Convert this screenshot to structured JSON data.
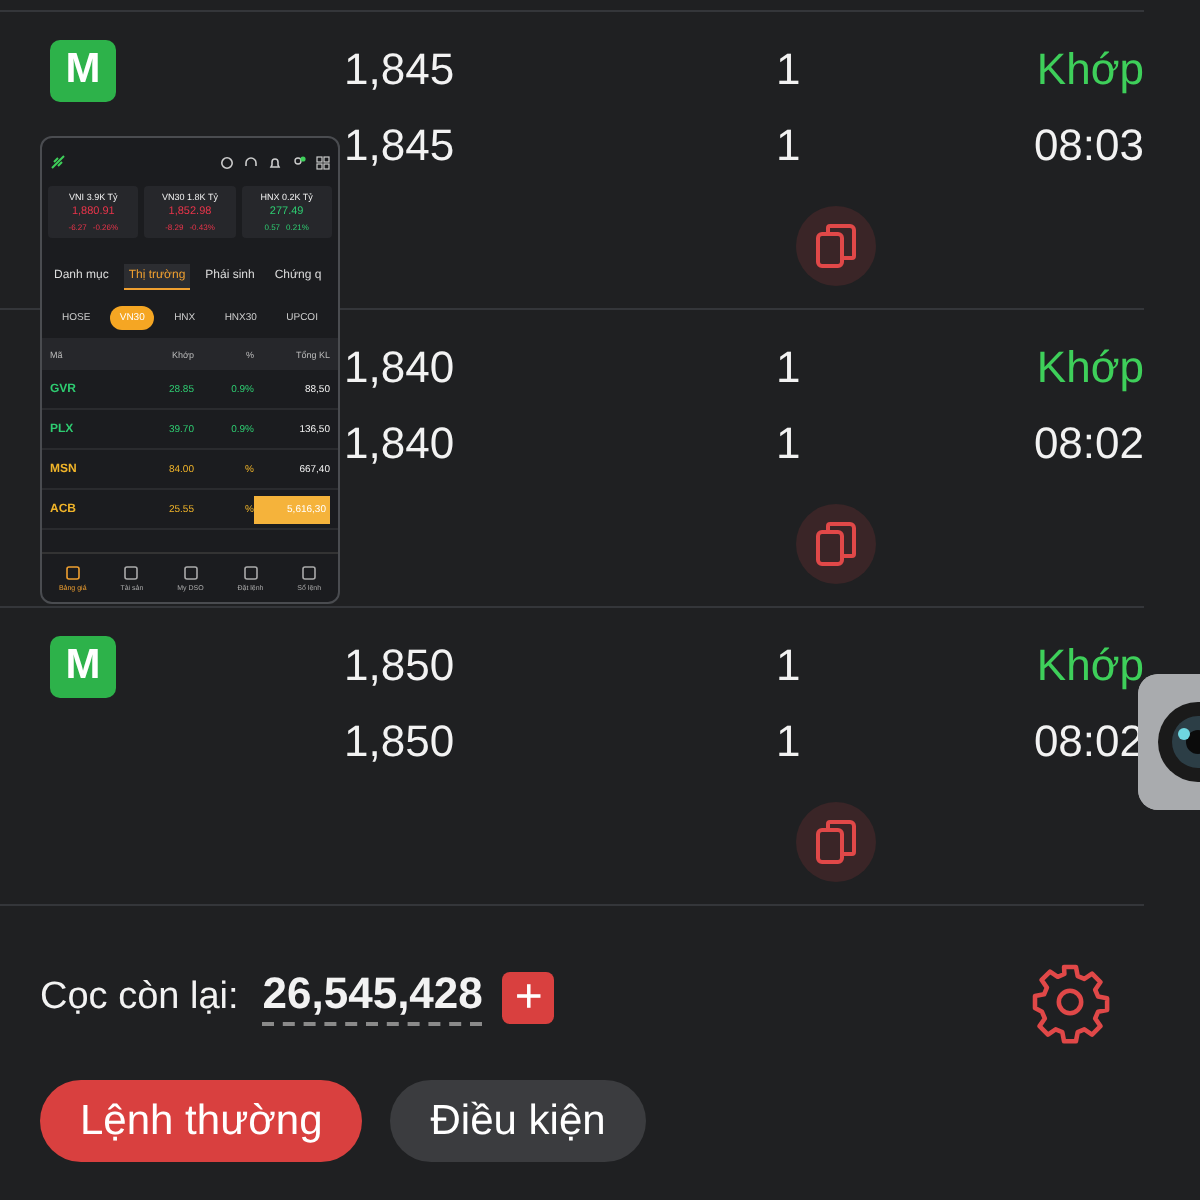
{
  "orders": [
    {
      "badge": "M",
      "price": "1,845",
      "qty": "1",
      "status": "Khớp",
      "price_2": "1,845",
      "qty_2": "1",
      "time": "08:03"
    },
    {
      "price": "1,840",
      "qty": "1",
      "status": "Khớp",
      "price_2": "1,840",
      "qty_2": "1",
      "time": "08:02"
    },
    {
      "badge": "M",
      "price": "1,850",
      "qty": "1",
      "status": "Khớp",
      "price_2": "1,850",
      "qty_2": "1",
      "time": "08:02"
    }
  ],
  "deposit": {
    "label": "Cọc còn lại:",
    "value": "26,545,428",
    "add": "+"
  },
  "order_tabs": [
    {
      "label": "Lệnh thường",
      "selected": true
    },
    {
      "label": "Điều kiện",
      "selected": false
    }
  ],
  "preview": {
    "indices": [
      {
        "name": "VNI",
        "volume": "3.9K Tỷ",
        "value": "1,880.91",
        "change": "-6.27",
        "percent": "-0.26%",
        "color": "#e8344a"
      },
      {
        "name": "VN30",
        "volume": "1.8K Tỷ",
        "value": "1,852.98",
        "change": "-8.29",
        "percent": "-0.43%",
        "color": "#e8344a"
      },
      {
        "name": "HNX",
        "volume": "0.2K Tỷ",
        "value": "277.49",
        "change": "0.57",
        "percent": "0.21%",
        "color": "#2ecc71"
      }
    ],
    "tabs": [
      {
        "label": "Danh mục",
        "selected": false
      },
      {
        "label": "Thị trường",
        "selected": true
      },
      {
        "label": "Phái sinh",
        "selected": false
      },
      {
        "label": "Chứng q",
        "selected": false
      }
    ],
    "exchanges": [
      {
        "label": "HOSE",
        "selected": false
      },
      {
        "label": "VN30",
        "selected": true
      },
      {
        "label": "HNX",
        "selected": false
      },
      {
        "label": "HNX30",
        "selected": false
      },
      {
        "label": "UPCOI",
        "selected": false
      }
    ],
    "columns": [
      "Mã",
      "Khớp",
      "%",
      "Tổng KL"
    ],
    "rows": [
      {
        "symbol": "GVR",
        "price": "28.85",
        "percent": "0.9%",
        "volume": "88,50",
        "color": "#2ecc71",
        "highlight": false
      },
      {
        "symbol": "PLX",
        "price": "39.70",
        "percent": "0.9%",
        "volume": "136,50",
        "color": "#2ecc71",
        "highlight": false
      },
      {
        "symbol": "MSN",
        "price": "84.00",
        "percent": "%",
        "volume": "667,40",
        "color": "#f0b429",
        "highlight": false
      },
      {
        "symbol": "ACB",
        "price": "25.55",
        "percent": "%",
        "volume": "5,616,30",
        "color": "#f0b429",
        "highlight": true
      }
    ],
    "nav": [
      {
        "label": "Bảng giá",
        "selected": true
      },
      {
        "label": "Tài sản",
        "selected": false
      },
      {
        "label": "My DSO",
        "selected": false
      },
      {
        "label": "Đặt lệnh",
        "selected": false
      },
      {
        "label": "Sổ lệnh",
        "selected": false
      }
    ]
  }
}
